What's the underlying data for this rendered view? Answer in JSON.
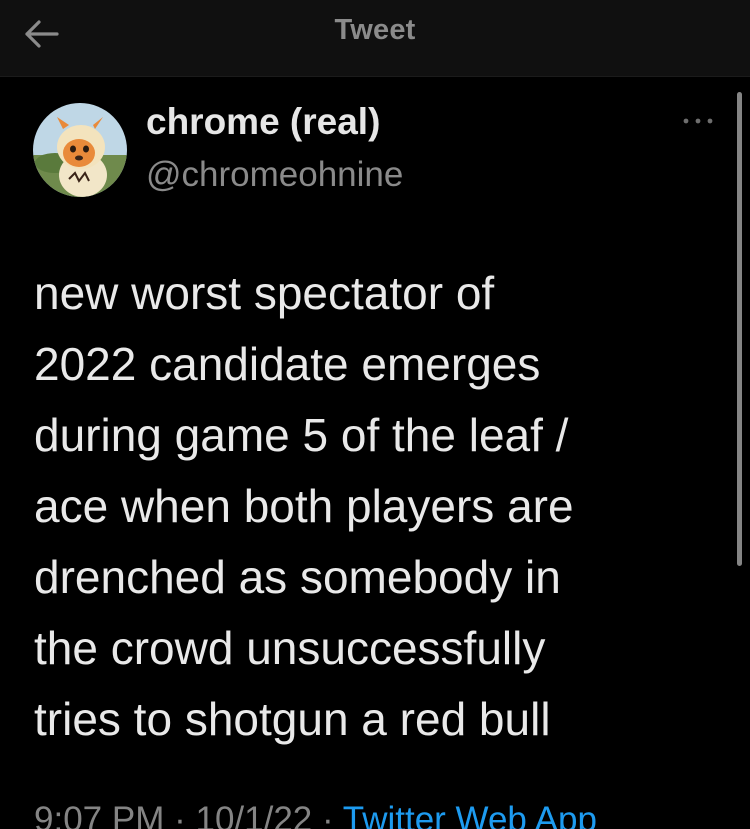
{
  "header": {
    "title": "Tweet",
    "back_icon": "arrow-left-icon"
  },
  "author": {
    "display_name": "chrome (real)",
    "handle": "@chromeohnine",
    "avatar_icon": "avatar-image"
  },
  "more_icon": "more-options-icon",
  "tweet": {
    "lines": [
      "new worst spectator of",
      "2022 candidate emerges",
      "during game 5 of the leaf /",
      "ace when both players are",
      "drenched as somebody in",
      "the crowd unsuccessfully",
      "tries to shotgun a red bull"
    ]
  },
  "meta": {
    "time": "9:07 PM",
    "separator": "·",
    "date": "10/1/22",
    "source": "Twitter Web App"
  },
  "colors": {
    "background": "#000000",
    "header_bg": "#101010",
    "text": "#e9e9e9",
    "muted": "#8a8a8a",
    "link": "#1d9bf0"
  }
}
